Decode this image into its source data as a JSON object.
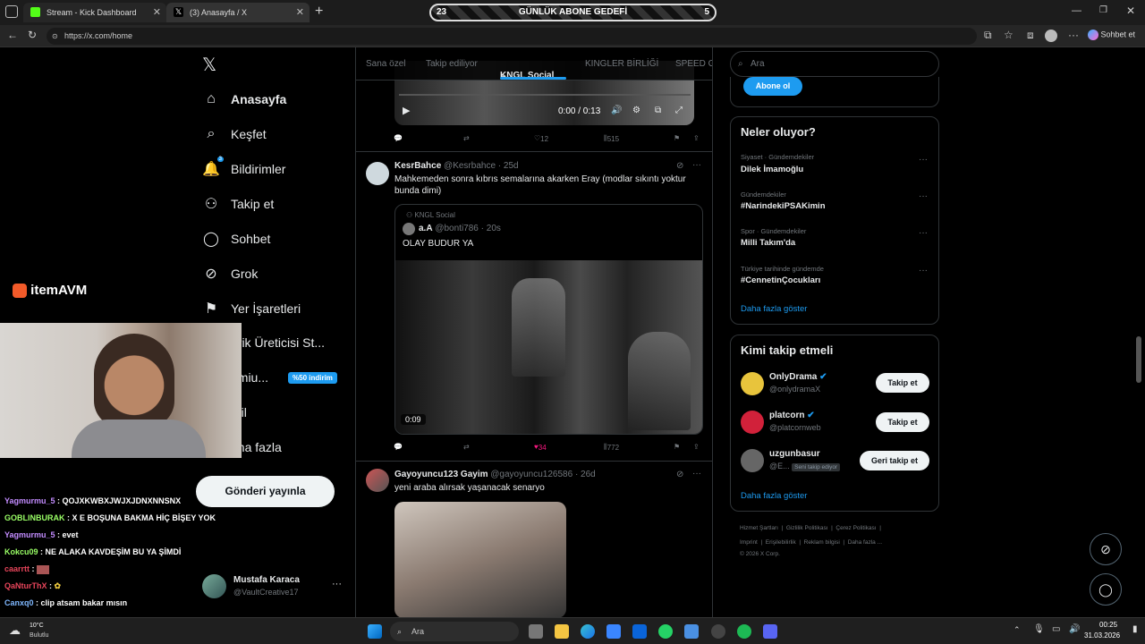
{
  "browser": {
    "tabs": [
      {
        "title": "Stream - Kick Dashboard"
      },
      {
        "title": "(3) Anasayfa / X"
      }
    ],
    "url": "https://x.com/home",
    "chat_button": "Sohbet et"
  },
  "overlay": {
    "goal_label": "GÜNLÜK ABONE GEDEFİ",
    "goal_current": "23",
    "goal_target": "5",
    "sponsor": "itemAVM",
    "chat": [
      {
        "user": "Yagmurmu_5",
        "msg": ": QOJXKWBXJWJXJDNXNNSNX",
        "color": "#c38cff"
      },
      {
        "user": "GOBLINBURAK",
        "msg": ": X E BOŞUNA BAKMA HİÇ BİŞEY YOK",
        "color": "#9aff66"
      },
      {
        "user": "Yagmurmu_5",
        "msg": ": evet",
        "color": "#c38cff"
      },
      {
        "user": "Kokcu09",
        "msg": ": NE ALAKA KAVDEŞİM BU YA ŞİMDİ",
        "color": "#9aff66"
      },
      {
        "user": "caarrtt",
        "msg": ":",
        "color": "#e8455b"
      },
      {
        "user": "QaNturThX",
        "msg": ":",
        "color": "#e8455b"
      },
      {
        "user": "Canxq0",
        "msg": ": clip atsam bakar mısın",
        "color": "#7fb8ff"
      }
    ]
  },
  "nav": {
    "items": [
      {
        "label": "Anasayfa",
        "icon": "home-icon"
      },
      {
        "label": "Keşfet",
        "icon": "search-icon"
      },
      {
        "label": "Bildirimler",
        "icon": "bell-icon"
      },
      {
        "label": "Takip et",
        "icon": "add-user-icon"
      },
      {
        "label": "Sohbet",
        "icon": "chat-icon"
      },
      {
        "label": "Grok",
        "icon": "grok-icon"
      },
      {
        "label": "Yer İşaretleri",
        "icon": "bookmark-icon"
      },
      {
        "label": "erik Üreticisi St...",
        "icon": "creator-icon"
      },
      {
        "label": "emiu...",
        "icon": "premium-icon"
      },
      {
        "label": "ofil",
        "icon": "profile-icon"
      },
      {
        "label": "aha fazla",
        "icon": "more-icon"
      }
    ],
    "premium_badge": "%50 indirim",
    "notification_count": "3",
    "post_button": "Gönderi yayınla",
    "account": {
      "name": "Mustafa Karaca",
      "handle": "@VaultCreative17"
    }
  },
  "feed": {
    "tabs": [
      "Sana özel",
      "Takip ediliyor",
      "KNGL Social",
      "KINGLER BİRLİĞİ",
      "SPEED G"
    ],
    "active_tab": "KNGL Social",
    "video_time": "0:00 / 0:13",
    "post0": {
      "replies": "",
      "reposts": "",
      "likes": "12",
      "views": "515"
    },
    "post1": {
      "name": "KesrBahce",
      "handle": "@Kesrbahce",
      "time": "· 25d",
      "text": "Mahkemeden sonra kıbrıs semalarına akarken Eray (modlar sıkıntı yoktur bunda dimi)",
      "quote": {
        "community": "KNGL Social",
        "name": "a.A",
        "handle": "@bonti786",
        "time": "· 20s",
        "text": "OLAY BUDUR YA",
        "duration": "0:09"
      },
      "likes": "34",
      "views": "772"
    },
    "post2": {
      "name": "Gayoyuncu123 Gayim",
      "handle": "@gayoyuncu126586",
      "time": "· 26d",
      "text": "yeni araba alırsak yaşanacak senaryo"
    }
  },
  "right": {
    "search_placeholder": "Ara",
    "subscribe_button": "Abone ol",
    "trends_title": "Neler oluyor?",
    "trends": [
      {
        "category": "Siyaset · Gündemdekiler",
        "name": "Dilek İmamoğlu"
      },
      {
        "category": "Gündemdekiler",
        "name": "#NarindekiPSAKimin"
      },
      {
        "category": "Spor · Gündemdekiler",
        "name": "Milli Takım'da"
      },
      {
        "category": "Türkiye tarihinde gündemde",
        "name": "#CennetinÇocukları"
      }
    ],
    "show_more": "Daha fazla göster",
    "follow_title": "Kimi takip etmeli",
    "follow": [
      {
        "name": "OnlyDrama",
        "handle": "@onlydramaX",
        "button": "Takip et",
        "verified": true
      },
      {
        "name": "platcorn",
        "handle": "@platcornweb",
        "button": "Takip et",
        "verified": true
      },
      {
        "name": "uzgunbasur",
        "handle": "@E...",
        "button": "Geri takip et",
        "tag": "Seni takip ediyor"
      }
    ],
    "show_more2": "Daha fazla göster",
    "footer_line1": [
      "Hizmet Şartları",
      "Gizlilik Politikası",
      "Çerez Politikası"
    ],
    "footer_line2": [
      "Imprint",
      "Erişilebilirlik",
      "Reklam bilgisi",
      "Daha fazla ..."
    ],
    "copyright": "© 2026 X Corp."
  },
  "taskbar": {
    "weather_temp": "10°C",
    "weather_desc": "Bulutlu",
    "search_label": "Ara",
    "time": "00:25",
    "date": "31.03.2026"
  },
  "colors": {
    "accent": "#1d9bf0",
    "like": "#f91880",
    "background": "#000000"
  }
}
